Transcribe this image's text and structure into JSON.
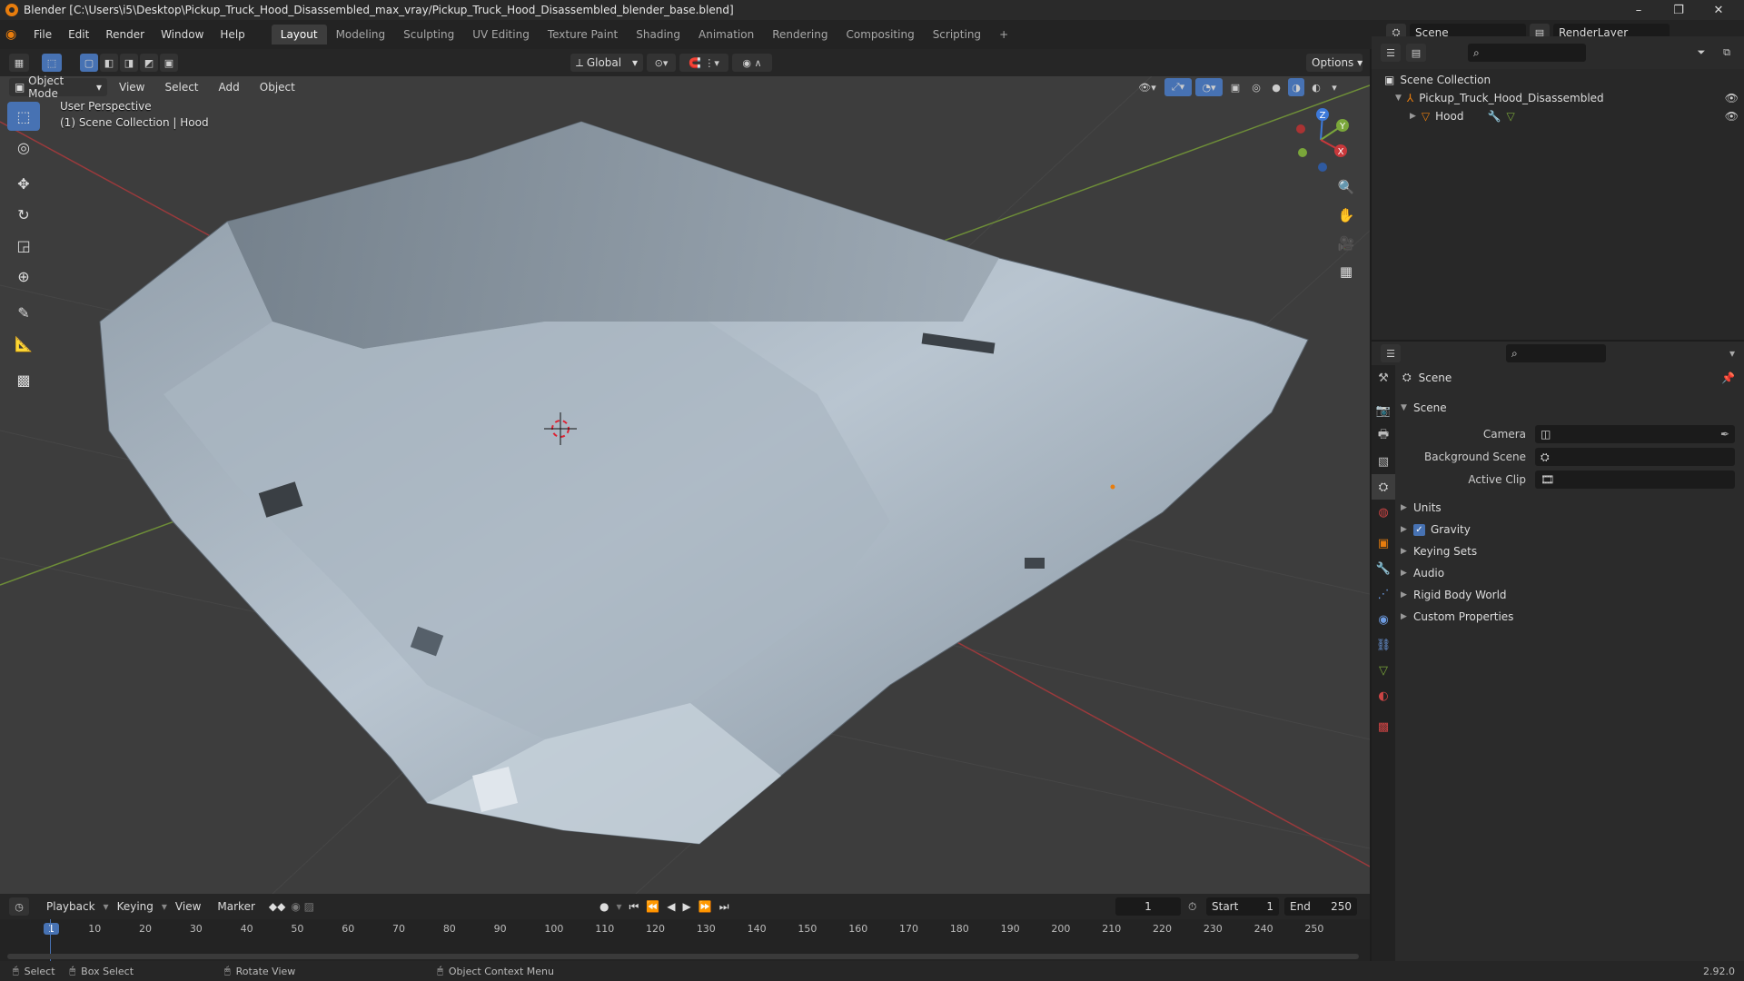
{
  "title": "Blender [C:\\Users\\i5\\Desktop\\Pickup_Truck_Hood_Disassembled_max_vray/Pickup_Truck_Hood_Disassembled_blender_base.blend]",
  "menu": [
    "File",
    "Edit",
    "Render",
    "Window",
    "Help"
  ],
  "workspaces": [
    "Layout",
    "Modeling",
    "Sculpting",
    "UV Editing",
    "Texture Paint",
    "Shading",
    "Animation",
    "Rendering",
    "Compositing",
    "Scripting"
  ],
  "active_workspace": "Layout",
  "add_tab": "+",
  "scene_field": "Scene",
  "renderlayer_field": "RenderLayer",
  "viewport": {
    "transform_orientation": "Global",
    "options": "Options",
    "mode": "Object Mode",
    "menus": [
      "View",
      "Select",
      "Add",
      "Object"
    ],
    "info_line1": "User Perspective",
    "info_line2": "(1) Scene Collection | Hood",
    "gizmo": {
      "x": "X",
      "y": "Y",
      "z": "Z"
    }
  },
  "outliner": {
    "root": "Scene Collection",
    "items": [
      {
        "label": "Pickup_Truck_Hood_Disassembled"
      },
      {
        "label": "Hood"
      }
    ]
  },
  "properties": {
    "context": "Scene",
    "panel": "Scene",
    "camera_label": "Camera",
    "bg_scene_label": "Background Scene",
    "active_clip_label": "Active Clip",
    "sections": [
      "Units",
      "Gravity",
      "Keying Sets",
      "Audio",
      "Rigid Body World",
      "Custom Properties"
    ],
    "gravity_checked": true
  },
  "timeline": {
    "menus": [
      "Playback",
      "Keying",
      "View",
      "Marker"
    ],
    "current_frame": "1",
    "start_label": "Start",
    "start": "1",
    "end_label": "End",
    "end": "250",
    "ticks": [
      "1",
      "10",
      "20",
      "30",
      "40",
      "50",
      "60",
      "70",
      "80",
      "90",
      "100",
      "110",
      "120",
      "130",
      "140",
      "150",
      "160",
      "170",
      "180",
      "190",
      "200",
      "210",
      "220",
      "230",
      "240",
      "250"
    ]
  },
  "status": {
    "select": "Select",
    "box_select": "Box Select",
    "rotate": "Rotate View",
    "context_menu": "Object Context Menu",
    "version": "2.92.0"
  },
  "colors": {
    "accent": "#4772b3",
    "x_axis": "#c8383b",
    "y_axis": "#7aa63a",
    "z_axis": "#3d79d9",
    "orange": "#e87d0d"
  }
}
